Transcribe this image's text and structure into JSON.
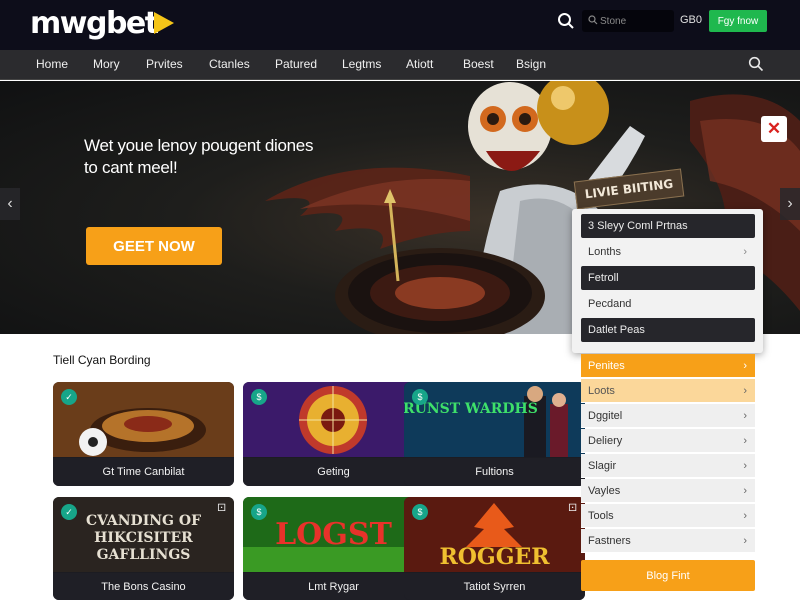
{
  "header": {
    "logo_text": "mwgbet",
    "search_placeholder": "Stone",
    "currency": "GB0",
    "signup_label": "Fgy fnow"
  },
  "nav": {
    "items": [
      {
        "label": "Home"
      },
      {
        "label": "Mory"
      },
      {
        "label": "Prvites"
      },
      {
        "label": "Ctanles"
      },
      {
        "label": "Patured"
      },
      {
        "label": "Legtms"
      },
      {
        "label": "Atiott"
      },
      {
        "label": "Boest"
      },
      {
        "label": "Bsign"
      }
    ]
  },
  "hero": {
    "title": "Wet youe lenoy pougent diones to cant meel!",
    "cta_label": "GEET NOW",
    "live_badge": "LIVIE BIITING",
    "close_symbol": "✕",
    "prev_symbol": "‹",
    "next_symbol": "›"
  },
  "dropdown": {
    "items": [
      {
        "label": "3 Sleyy Coml Prtnas",
        "style": "dark"
      },
      {
        "label": "Lonths",
        "style": "light"
      },
      {
        "label": "Fetroll",
        "style": "dark"
      },
      {
        "label": "Pecdand",
        "style": "light"
      },
      {
        "label": "Datlet Peas",
        "style": "dark"
      }
    ]
  },
  "section": {
    "title": "Tiell Cyan Bording"
  },
  "games": [
    {
      "label": "Gt Time Canbilat",
      "art_text": ""
    },
    {
      "label": "Geting",
      "art_text": ""
    },
    {
      "label": "Fultions",
      "art_text": "BRUNST WARDHS"
    },
    {
      "label": "The Bons Casino",
      "art_text": "CVANDING OF HIKCISITER GAFLLINGS"
    },
    {
      "label": "Lmt Rygar",
      "art_text": "LOGST"
    },
    {
      "label": "Tatiot Syrren",
      "art_text": "ROGGER"
    }
  ],
  "side_menu": {
    "items": [
      {
        "label": "Penites",
        "state": "active"
      },
      {
        "label": "Loots",
        "state": "highlight"
      },
      {
        "label": "Dggitel",
        "state": ""
      },
      {
        "label": "Deliery",
        "state": ""
      },
      {
        "label": "Slagir",
        "state": ""
      },
      {
        "label": "Vayles",
        "state": ""
      },
      {
        "label": "Tools",
        "state": ""
      },
      {
        "label": "Fastners",
        "state": ""
      }
    ],
    "cta_label": "Blog Fint"
  },
  "colors": {
    "brand_yellow": "#f5c518",
    "accent_orange": "#f7a018",
    "signup_green": "#1fb84e",
    "header_bg": "#0d0d1a",
    "nav_bg": "#2b2b2e"
  }
}
